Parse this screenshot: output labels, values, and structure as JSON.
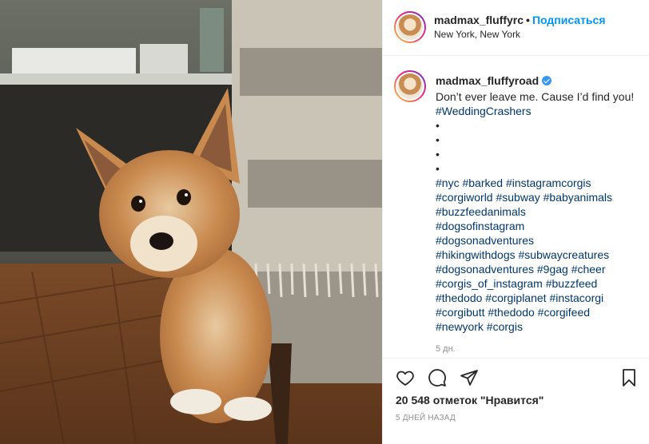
{
  "post": {
    "image_alt": "corgi peeking from behind a sofa",
    "author": {
      "username": "madmax_fluffyroad",
      "username_truncated": "madmax_fluffyrc",
      "verified": true,
      "location": "New York, New York",
      "follow_label": "Подписаться",
      "separator": "•"
    },
    "caption": {
      "text": "Don’t ever leave me. Cause I’d find you! ",
      "hashtag": "#WeddingCrashers",
      "bullets": [
        "•",
        "•",
        "•",
        "•"
      ],
      "hashtag_lines": [
        "#nyc #barked #instagramcorgis",
        "#corgiworld #subway #babyanimals",
        "#buzzfeedanimals",
        "#dogsofinstagram",
        "#dogsonadventures",
        "#hikingwithdogs #subwaycreatures",
        "#dogsonadventures #9gag #cheer",
        "#corgis_of_instagram #buzzfeed",
        "#thedodo #corgiplanet #instacorgi",
        "#corgibutt #thedodo #corgifeed",
        "#newyork #corgis"
      ],
      "age": "5 дн."
    },
    "actions": {
      "like_icon": "heart-icon",
      "comment_icon": "comment-icon",
      "share_icon": "share-icon",
      "save_icon": "bookmark-icon"
    },
    "likes_text": "20 548 отметок \"Нравится\"",
    "date_text": "5 ДНЕЙ НАЗАД"
  },
  "colors": {
    "link_blue": "#0095f6",
    "hashtag": "#00376b",
    "muted": "#8e8e8e",
    "verified": "#3897f0"
  }
}
